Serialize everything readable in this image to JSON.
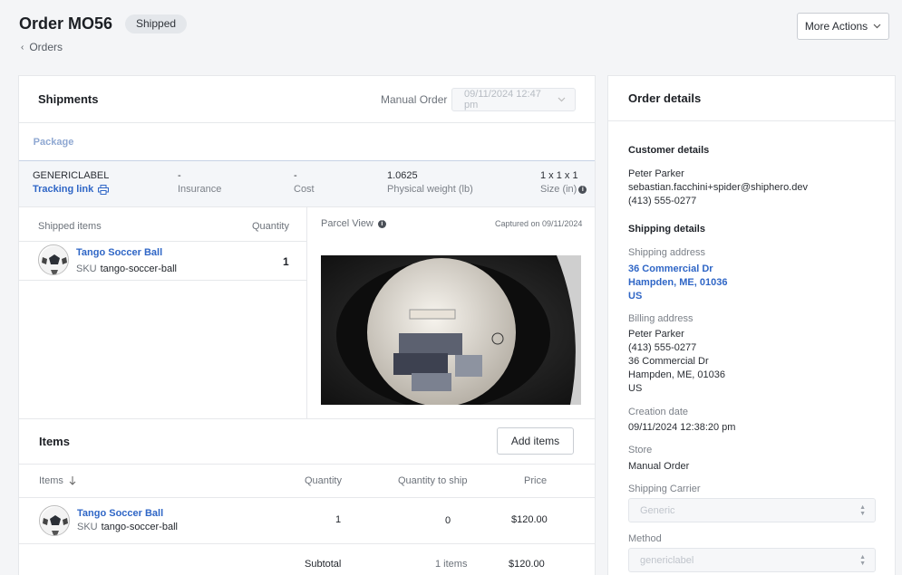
{
  "header": {
    "title": "Order MO56",
    "status_badge": "Shipped",
    "breadcrumb": "Orders",
    "more_actions_label": "More Actions"
  },
  "shipments": {
    "title": "Shipments",
    "order_type": "Manual Order",
    "date_value": "09/11/2024 12:47 pm",
    "tab_label": "Package",
    "package": {
      "label_name": "GENERICLABEL",
      "tracking_link": "Tracking link",
      "insurance_value": "-",
      "insurance_label": "Insurance",
      "cost_value": "-",
      "cost_label": "Cost",
      "weight_value": "1.0625",
      "weight_label": "Physical weight (lb)",
      "size_value": "1 x 1 x 1",
      "size_label": "Size (in)"
    },
    "shipped_items": {
      "col_item": "Shipped items",
      "col_qty": "Quantity",
      "rows": [
        {
          "name": "Tango Soccer Ball",
          "sku_label": "SKU",
          "sku": "tango-soccer-ball",
          "quantity": "1"
        }
      ]
    },
    "parcel_view": {
      "label": "Parcel View",
      "captured": "Captured on 09/11/2024"
    }
  },
  "items": {
    "title": "Items",
    "add_button": "Add items",
    "columns": {
      "item": "Items",
      "quantity": "Quantity",
      "to_ship": "Quantity to ship",
      "price": "Price"
    },
    "rows": [
      {
        "name": "Tango Soccer Ball",
        "sku_label": "SKU",
        "sku": "tango-soccer-ball",
        "quantity": "1",
        "to_ship": "0",
        "price": "$120.00"
      }
    ],
    "subtotal": {
      "label": "Subtotal",
      "count": "1 items",
      "amount": "$120.00"
    }
  },
  "order_details": {
    "title": "Order details",
    "customer_title": "Customer details",
    "customer": {
      "name": "Peter Parker",
      "email": "sebastian.facchini+spider@shiphero.dev",
      "phone": "(413) 555-0277"
    },
    "shipping_title": "Shipping details",
    "shipping_address_label": "Shipping address",
    "shipping_address": [
      "36 Commercial Dr",
      "Hampden, ME, 01036",
      "US"
    ],
    "billing_address_label": "Billing address",
    "billing_address": [
      "Peter Parker",
      "(413) 555-0277",
      "36 Commercial Dr",
      "Hampden, ME, 01036",
      "US"
    ],
    "creation_label": "Creation date",
    "creation_value": "09/11/2024 12:38:20 pm",
    "store_label": "Store",
    "store_value": "Manual Order",
    "carrier_label": "Shipping Carrier",
    "carrier_value": "Generic",
    "method_label": "Method",
    "method_value": "genericlabel"
  },
  "colors": {
    "link": "#2f66c6",
    "badge_bg": "#e4e7eb",
    "page_bg": "#f4f5f7"
  }
}
